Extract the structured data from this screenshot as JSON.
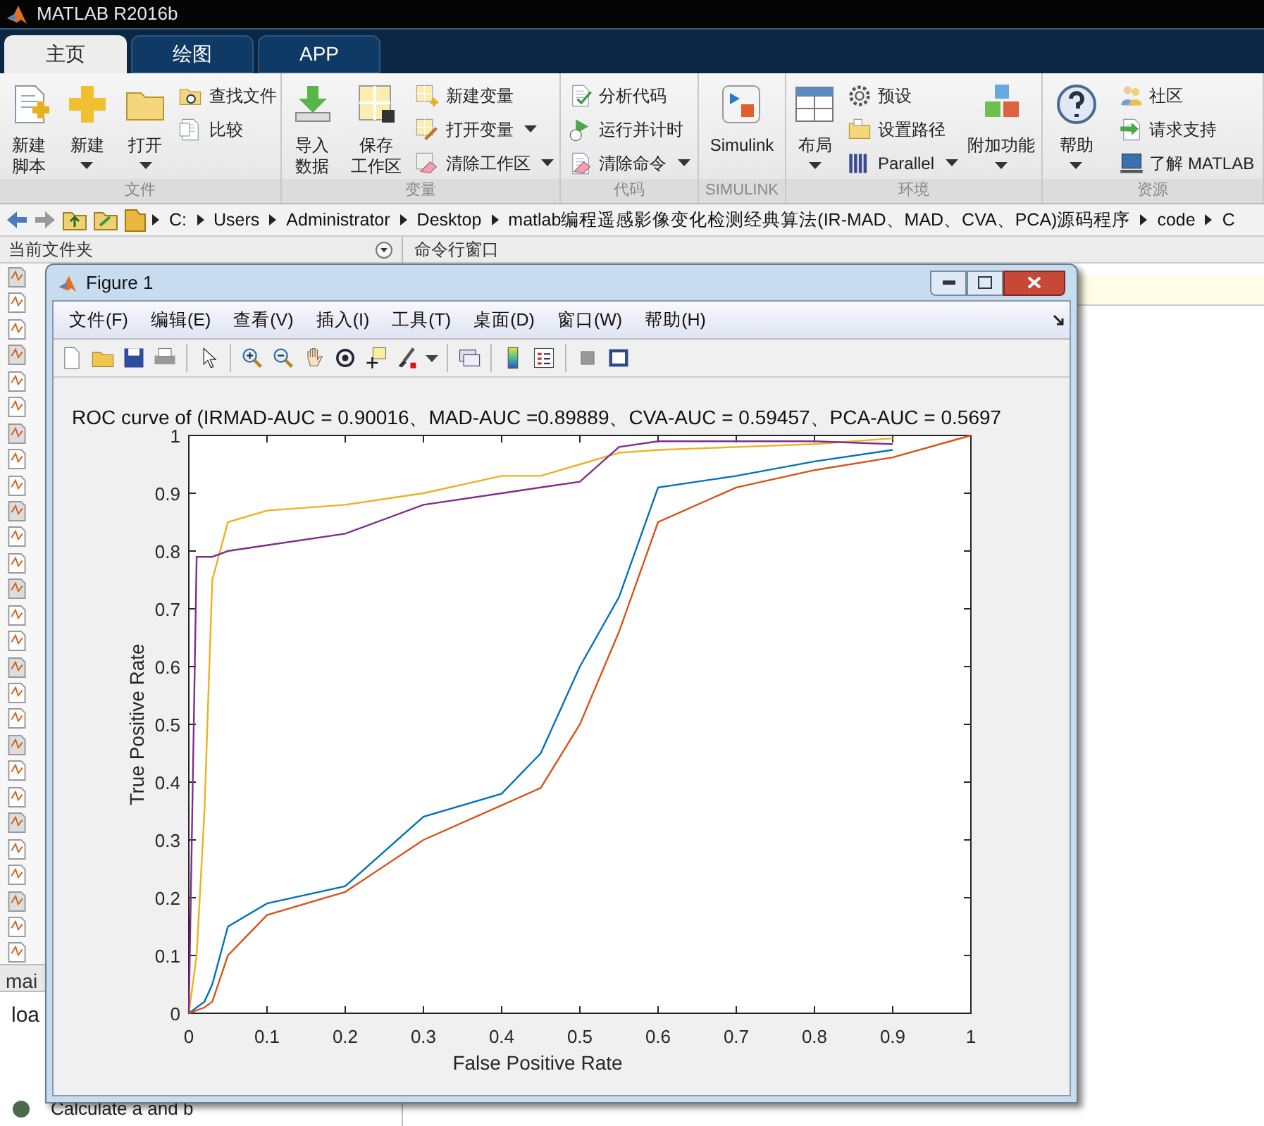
{
  "app_title": "MATLAB R2016b",
  "tabs": [
    {
      "label": "主页",
      "selected": true
    },
    {
      "label": "绘图",
      "selected": false
    },
    {
      "label": "APP",
      "selected": false
    }
  ],
  "toolstrip": [
    {
      "label": "文件",
      "items": [
        {
          "kind": "large",
          "lines": [
            "新建",
            "脚本"
          ],
          "dropdown": false
        },
        {
          "kind": "large",
          "lines": [
            "新建"
          ],
          "dropdown": true
        },
        {
          "kind": "large",
          "lines": [
            "打开"
          ],
          "dropdown": true
        },
        {
          "kind": "column",
          "entries": [
            {
              "label": "查找文件",
              "dropdown": false
            },
            {
              "label": "比较",
              "dropdown": false
            }
          ]
        }
      ]
    },
    {
      "label": "变量",
      "items": [
        {
          "kind": "large",
          "lines": [
            "导入",
            "数据"
          ],
          "dropdown": false
        },
        {
          "kind": "large",
          "lines": [
            "保存",
            "工作区"
          ],
          "dropdown": false
        },
        {
          "kind": "column",
          "entries": [
            {
              "label": "新建变量",
              "dropdown": false
            },
            {
              "label": "打开变量",
              "dropdown": true
            },
            {
              "label": "清除工作区",
              "dropdown": true
            }
          ]
        }
      ]
    },
    {
      "label": "代码",
      "items": [
        {
          "kind": "column",
          "entries": [
            {
              "label": "分析代码",
              "dropdown": false
            },
            {
              "label": "运行并计时",
              "dropdown": false
            },
            {
              "label": "清除命令",
              "dropdown": true
            }
          ]
        }
      ]
    },
    {
      "label": "SIMULINK",
      "items": [
        {
          "kind": "large",
          "lines": [
            "Simulink"
          ],
          "dropdown": false
        }
      ]
    },
    {
      "label": "环境",
      "items": [
        {
          "kind": "large",
          "lines": [
            "布局"
          ],
          "dropdown": true
        },
        {
          "kind": "column",
          "entries": [
            {
              "label": "预设",
              "dropdown": false
            },
            {
              "label": "设置路径",
              "dropdown": false
            },
            {
              "label": "Parallel",
              "dropdown": true
            }
          ]
        },
        {
          "kind": "large",
          "lines": [
            "附加功能"
          ],
          "dropdown": true
        }
      ]
    },
    {
      "label": "资源",
      "items": [
        {
          "kind": "large",
          "lines": [
            "帮助"
          ],
          "dropdown": true
        },
        {
          "kind": "column",
          "entries": [
            {
              "label": "社区",
              "dropdown": false
            },
            {
              "label": "请求支持",
              "dropdown": false
            },
            {
              "label": "了解 MATLAB",
              "dropdown": false
            }
          ]
        }
      ]
    }
  ],
  "address_path": [
    "C:",
    "Users",
    "Administrator",
    "Desktop",
    "matlab编程遥感影像变化检测经典算法(IR-MAD、MAD、CVA、PCA)源码程序",
    "code",
    "C"
  ],
  "left_panel": {
    "title": "当前文件夹",
    "tab": "mai",
    "lines": [
      "loa",
      "Calculate a and b"
    ]
  },
  "command_window": {
    "title": "命令行窗口"
  },
  "figure": {
    "title": "Figure 1",
    "menus": [
      "文件(F)",
      "编辑(E)",
      "查看(V)",
      "插入(I)",
      "工具(T)",
      "桌面(D)",
      "窗口(W)",
      "帮助(H)"
    ],
    "chart_data": {
      "type": "line",
      "title": "ROC curve of (IRMAD-AUC = 0.90016、MAD-AUC =0.89889、CVA-AUC = 0.59457、PCA-AUC = 0.5697",
      "xlabel": "False Positive Rate",
      "ylabel": "True Positive Rate",
      "x": [
        0,
        0.01,
        0.02,
        0.03,
        0.05,
        0.1,
        0.2,
        0.3,
        0.4,
        0.45,
        0.5,
        0.55,
        0.6,
        0.7,
        0.8,
        0.9,
        1
      ],
      "series": [
        {
          "color": "#edb120",
          "values": [
            0,
            0.1,
            0.35,
            0.75,
            0.85,
            0.87,
            0.88,
            0.9,
            0.93,
            0.93,
            0.95,
            0.97,
            0.975,
            0.98,
            0.985,
            0.995,
            null
          ]
        },
        {
          "color": "#7e2f8e",
          "values": [
            0,
            0.79,
            0.79,
            0.79,
            0.8,
            0.81,
            0.83,
            0.88,
            0.9,
            0.91,
            0.92,
            0.98,
            0.99,
            0.99,
            0.99,
            0.985,
            null
          ]
        },
        {
          "color": "#0072bd",
          "values": [
            0,
            0.01,
            0.02,
            0.05,
            0.15,
            0.19,
            0.22,
            0.34,
            0.38,
            0.45,
            0.6,
            0.72,
            0.91,
            0.93,
            0.955,
            0.975,
            null
          ]
        },
        {
          "color": "#d95319",
          "values": [
            0,
            0.005,
            0.01,
            0.02,
            0.1,
            0.17,
            0.21,
            0.3,
            0.36,
            0.39,
            0.5,
            0.66,
            0.85,
            0.91,
            0.94,
            0.962,
            1
          ]
        }
      ],
      "xlim": [
        0,
        1
      ],
      "ylim": [
        0,
        1
      ],
      "xticks": [
        0,
        0.1,
        0.2,
        0.3,
        0.4,
        0.5,
        0.6,
        0.7,
        0.8,
        0.9,
        1
      ],
      "yticks": [
        0,
        0.1,
        0.2,
        0.3,
        0.4,
        0.5,
        0.6,
        0.7,
        0.8,
        0.9,
        1
      ]
    }
  }
}
